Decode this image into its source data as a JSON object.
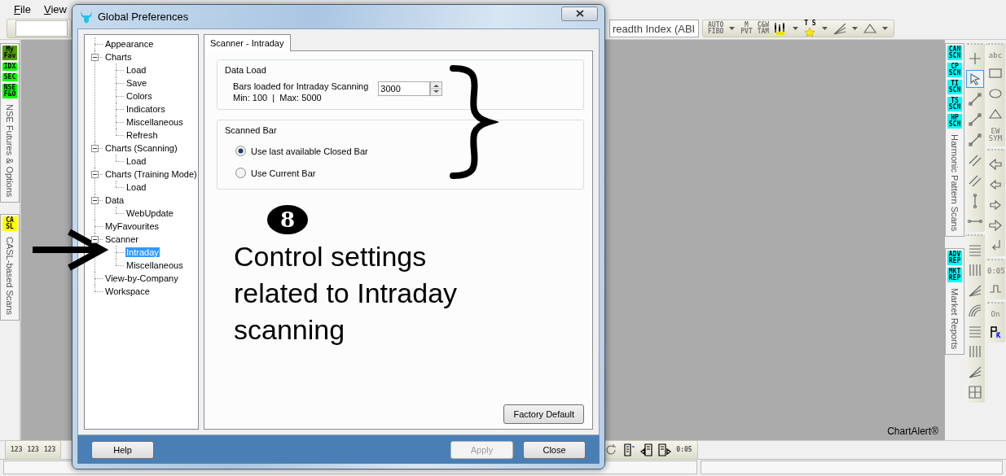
{
  "menu": [
    {
      "label": "File"
    },
    {
      "label": "View"
    }
  ],
  "top_toolbar": {
    "combo": {
      "value": "readth Index (ABI"
    },
    "tools": [
      {
        "kind": "text",
        "label": "AUTO\nFIBO",
        "dropdown": true
      },
      {
        "kind": "text",
        "label": "M\nPVT",
        "dropdown": false
      },
      {
        "kind": "text",
        "label": "C&W\nTAM",
        "dropdown": false
      },
      {
        "kind": "candles",
        "dropdown": true
      },
      {
        "kind": "star",
        "label": "T S",
        "dropdown": true
      },
      {
        "kind": "fan",
        "dropdown": true
      },
      {
        "kind": "triangle",
        "dropdown": true
      }
    ]
  },
  "left_panels": [
    {
      "badges": [
        {
          "label": "My\nFav",
          "color": "#4c9c00"
        },
        {
          "label": "IDX",
          "color": "#00ff00"
        },
        {
          "label": "SEC",
          "color": "#00ff00"
        },
        {
          "label": "NSE\nF&O",
          "color": "#00ff00"
        }
      ],
      "title": "NSE Futures & Options"
    },
    {
      "badges": [
        {
          "label": "CA\nSL",
          "color": "#ffff00"
        }
      ],
      "title": "CASL-based Scans"
    }
  ],
  "canvas": {
    "brand": "ChartAlert®"
  },
  "right_panels": [
    {
      "badges": [
        {
          "label": "CAN\nSCN",
          "color": "#00ffff"
        },
        {
          "label": "CP\nSCN",
          "color": "#00ffff"
        },
        {
          "label": "TI\nSCN",
          "color": "#00ffff"
        },
        {
          "label": "TS\nSCN",
          "color": "#00ffff"
        },
        {
          "label": "HP\nSCN",
          "color": "#00ffff"
        }
      ],
      "title": "Harmonic Pattern Scans"
    },
    {
      "badges": [
        {
          "label": "ADV\nREP",
          "color": "#00ffff"
        },
        {
          "label": "MKT\nREP",
          "color": "#00ffff"
        }
      ],
      "title": "Market Reports"
    }
  ],
  "drawing_toolbars": [
    {
      "groups": [
        {
          "tools": [
            {
              "kind": "plus",
              "selected": false
            },
            {
              "kind": "cursor",
              "selected": true
            },
            {
              "kind": "line",
              "selected": false
            },
            {
              "kind": "line",
              "selected": false
            },
            {
              "kind": "line",
              "selected": false
            },
            {
              "kind": "channel",
              "selected": false
            },
            {
              "kind": "channel",
              "selected": false
            },
            {
              "kind": "vsegment",
              "selected": false
            },
            {
              "kind": "hsegment",
              "selected": false
            }
          ]
        },
        {
          "tools": [
            {
              "kind": "hlines",
              "selected": false
            },
            {
              "kind": "vlines",
              "selected": false
            },
            {
              "kind": "fan",
              "selected": false
            },
            {
              "kind": "arcs",
              "selected": false
            },
            {
              "kind": "hlines",
              "selected": false
            },
            {
              "kind": "vlines",
              "selected": false
            },
            {
              "kind": "fan",
              "selected": false
            },
            {
              "kind": "grid",
              "selected": false
            }
          ]
        }
      ]
    },
    {
      "groups": [
        {
          "tools": [
            {
              "kind": "text",
              "label": "abc",
              "selected": false
            },
            {
              "kind": "rect",
              "selected": false
            },
            {
              "kind": "ellipse",
              "selected": false
            },
            {
              "kind": "triangle",
              "selected": false
            },
            {
              "kind": "text",
              "label": "EW\nSYM",
              "selected": false
            }
          ]
        },
        {
          "tools": [
            {
              "kind": "bigleft",
              "selected": false
            },
            {
              "kind": "left",
              "selected": false
            },
            {
              "kind": "right",
              "selected": false
            },
            {
              "kind": "bigright",
              "selected": false
            },
            {
              "kind": "return",
              "selected": false
            }
          ]
        },
        {
          "tools": [
            {
              "kind": "text",
              "label": "0:05",
              "selected": false
            },
            {
              "kind": "step",
              "selected": false
            }
          ]
        },
        {
          "tools": [
            {
              "kind": "text",
              "label": "On",
              "selected": false
            },
            {
              "kind": "flagr",
              "selected": false
            }
          ]
        }
      ]
    }
  ],
  "bottom_toolbar": {
    "left_tools": [
      {
        "kind": "num",
        "label": "123"
      },
      {
        "kind": "num",
        "label": "123"
      },
      {
        "kind": "num",
        "label": "123"
      }
    ],
    "right_tools": [
      {
        "kind": "refresh"
      },
      {
        "kind": "doc"
      },
      {
        "kind": "docleft"
      },
      {
        "kind": "docright"
      },
      {
        "kind": "num",
        "label": "0:05"
      }
    ]
  },
  "dialog": {
    "title": "Global Preferences",
    "tree": [
      {
        "label": "Appearance",
        "selected": false
      },
      {
        "label": "Charts",
        "selected": false,
        "expanded": true,
        "children": [
          {
            "label": "Load",
            "selected": false
          },
          {
            "label": "Save",
            "selected": false
          },
          {
            "label": "Colors",
            "selected": false
          },
          {
            "label": "Indicators",
            "selected": false
          },
          {
            "label": "Miscellaneous",
            "selected": false
          },
          {
            "label": "Refresh",
            "selected": false
          }
        ]
      },
      {
        "label": "Charts (Scanning)",
        "selected": false,
        "expanded": true,
        "children": [
          {
            "label": "Load",
            "selected": false
          }
        ]
      },
      {
        "label": "Charts (Training Mode)",
        "selected": false,
        "expanded": true,
        "children": [
          {
            "label": "Load",
            "selected": false
          }
        ]
      },
      {
        "label": "Data",
        "selected": false,
        "expanded": true,
        "children": [
          {
            "label": "WebUpdate",
            "selected": false
          }
        ]
      },
      {
        "label": "MyFavourites",
        "selected": false
      },
      {
        "label": "Scanner",
        "selected": false,
        "expanded": true,
        "children": [
          {
            "label": "Intraday",
            "selected": true
          },
          {
            "label": "Miscellaneous",
            "selected": false
          }
        ]
      },
      {
        "label": "View-by-Company",
        "selected": false
      },
      {
        "label": "Workspace",
        "selected": false
      }
    ],
    "tabs": [
      {
        "label": "Scanner - Intraday",
        "selected": true
      }
    ],
    "data_load": {
      "title": "Data Load",
      "label": "Bars loaded for Intraday Scanning",
      "value": "3000",
      "range": "Min: 100  |  Max: 5000"
    },
    "scanned_bar": {
      "title": "Scanned Bar",
      "options": [
        {
          "label": "Use last available Closed Bar",
          "selected": true
        },
        {
          "label": "Use Current Bar",
          "selected": false
        }
      ]
    },
    "factory_button": "Factory Default",
    "footer_buttons": [
      {
        "label": "Help",
        "disabled": false
      },
      {
        "label": "Apply",
        "disabled": true
      },
      {
        "label": "Close",
        "disabled": false
      }
    ]
  },
  "annotations": {
    "step": "8",
    "note": "Control settings related to Intraday scanning"
  }
}
